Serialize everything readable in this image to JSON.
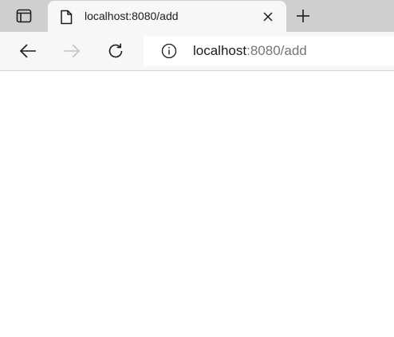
{
  "tab": {
    "title": "localhost:8080/add"
  },
  "address_bar": {
    "host": "localhost",
    "rest": ":8080/add"
  },
  "icons": {
    "tab_actions": "tab-actions-icon",
    "favicon": "page-icon",
    "close": "close-icon",
    "new_tab": "plus-icon",
    "back": "arrow-left-icon",
    "forward": "arrow-right-icon",
    "refresh": "refresh-icon",
    "site_info": "info-icon"
  },
  "colors": {
    "tabstrip": "#cfcfcf",
    "active_tab": "#f7f7f7",
    "toolbar": "#f7f7f7",
    "url_host": "#1b1b1b",
    "url_rest": "#767676",
    "disabled_icon": "#c4c4c4"
  }
}
